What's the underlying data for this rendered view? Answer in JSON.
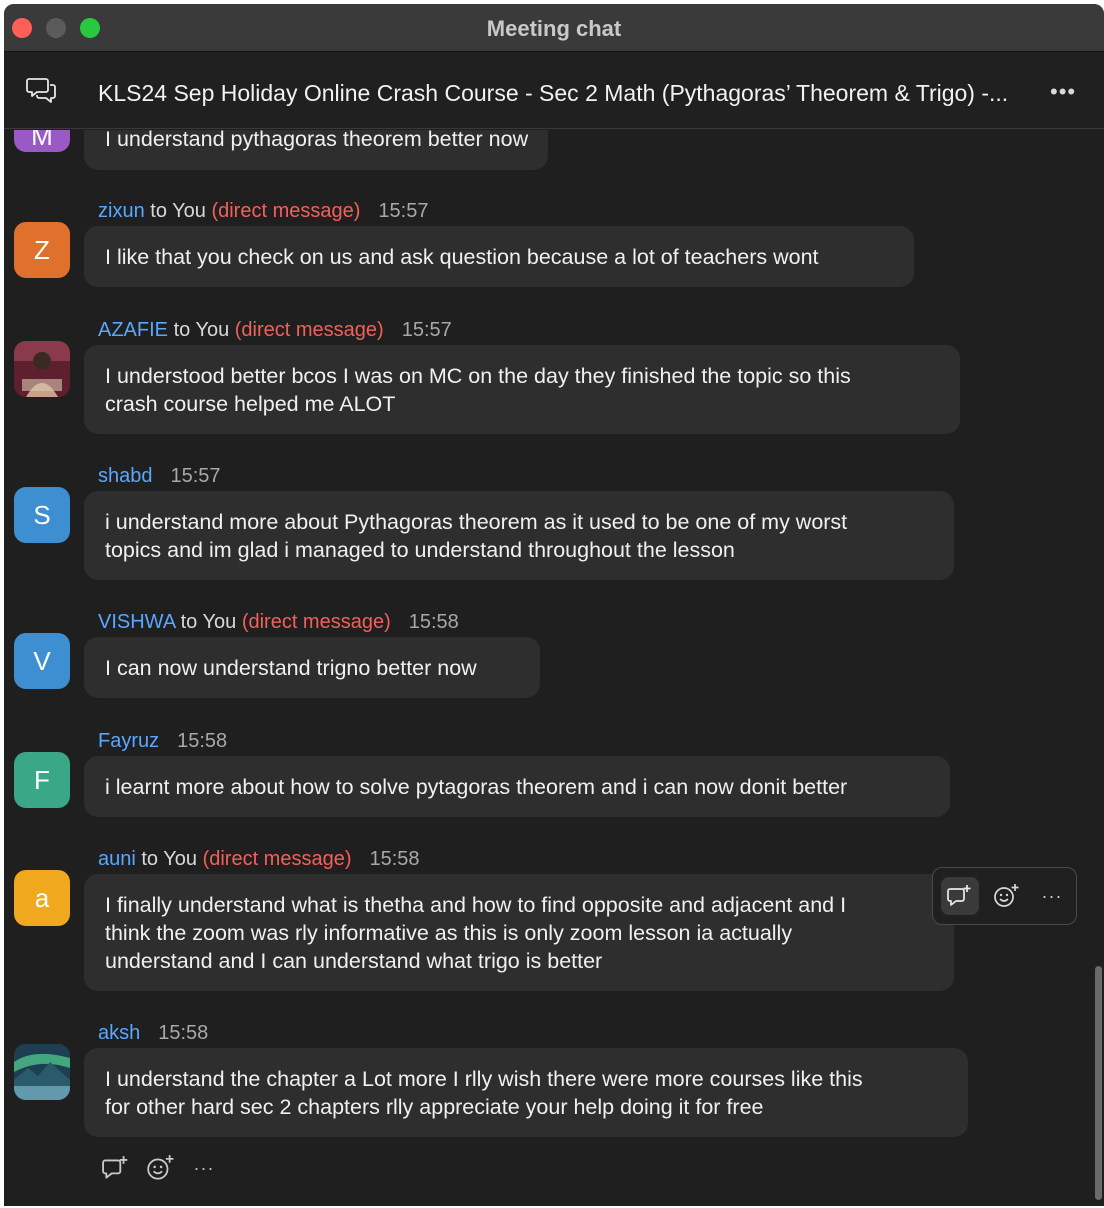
{
  "window": {
    "title": "Meeting chat"
  },
  "header": {
    "chat_title": "KLS24 Sep Holiday Online Crash Course - Sec 2 Math (Pythagoras’ Theorem & Trigo) -...",
    "more_label": "•••",
    "chat_icon": "chat-bubbles-icon"
  },
  "partial_message": {
    "avatar_initial": "M",
    "avatar_color": "#9b59c6",
    "text": "I understand pythagoras theorem better now"
  },
  "messages": [
    {
      "sender": "zixun",
      "to": " to You ",
      "dm": "(direct message)",
      "time": "15:57",
      "avatar_initial": "Z",
      "avatar_color": "#e0712c",
      "text_lines": [
        "I like that you check on us and ask question because a lot of teachers wont"
      ]
    },
    {
      "sender": "AZAFIE",
      "to": " to You ",
      "dm": "(direct message)",
      "time": "15:57",
      "avatar_initial": "",
      "avatar_color": "#7a2a3a",
      "avatar_image": "photo-avatar",
      "text_lines": [
        "I understood better bcos I was on MC on the day they finished the topic so this",
        "crash course helped me ALOT"
      ]
    },
    {
      "sender": "shabd",
      "to": "",
      "dm": "",
      "time": "15:57",
      "avatar_initial": "S",
      "avatar_color": "#3d8fd1",
      "text_lines": [
        "i understand more about Pythagoras theorem as it used to be one of my worst",
        "topics and im glad i managed to understand throughout the lesson"
      ]
    },
    {
      "sender": "VISHWA",
      "to": " to You ",
      "dm": "(direct message)",
      "time": "15:58",
      "avatar_initial": "V",
      "avatar_color": "#3d8fd1",
      "text_lines": [
        "I can now understand trigno better now"
      ]
    },
    {
      "sender": "Fayruz",
      "to": "",
      "dm": "",
      "time": "15:58",
      "avatar_initial": "F",
      "avatar_color": "#3aa887",
      "text_lines": [
        "i learnt more about how to solve pytagoras theorem and i can now donit better"
      ]
    },
    {
      "sender": "auni",
      "to": " to You ",
      "dm": "(direct message)",
      "time": "15:58",
      "avatar_initial": "a",
      "avatar_color": "#f0a81e",
      "text_lines": [
        "I finally understand what is thetha and how to find opposite and adjacent and I",
        "think the zoom was rly informative as this is only zoom lesson ia actually",
        "understand and I can understand what trigo is better"
      ]
    },
    {
      "sender": "aksh",
      "to": "",
      "dm": "",
      "time": "15:58",
      "avatar_initial": "",
      "avatar_color": "#2e6a7a",
      "avatar_image": "landscape-avatar",
      "text_lines": [
        "I understand the chapter a Lot more I rlly wish there were more courses like this",
        "for other hard sec 2 chapters rlly appreciate your help doing it for free"
      ]
    }
  ],
  "hover_toolbar": {
    "reply_icon": "reply-thread-icon",
    "react_icon": "add-reaction-icon",
    "more_label": "···"
  },
  "bottom_actions": {
    "reply_icon": "reply-thread-icon",
    "react_icon": "add-reaction-icon",
    "more_label": "···"
  }
}
